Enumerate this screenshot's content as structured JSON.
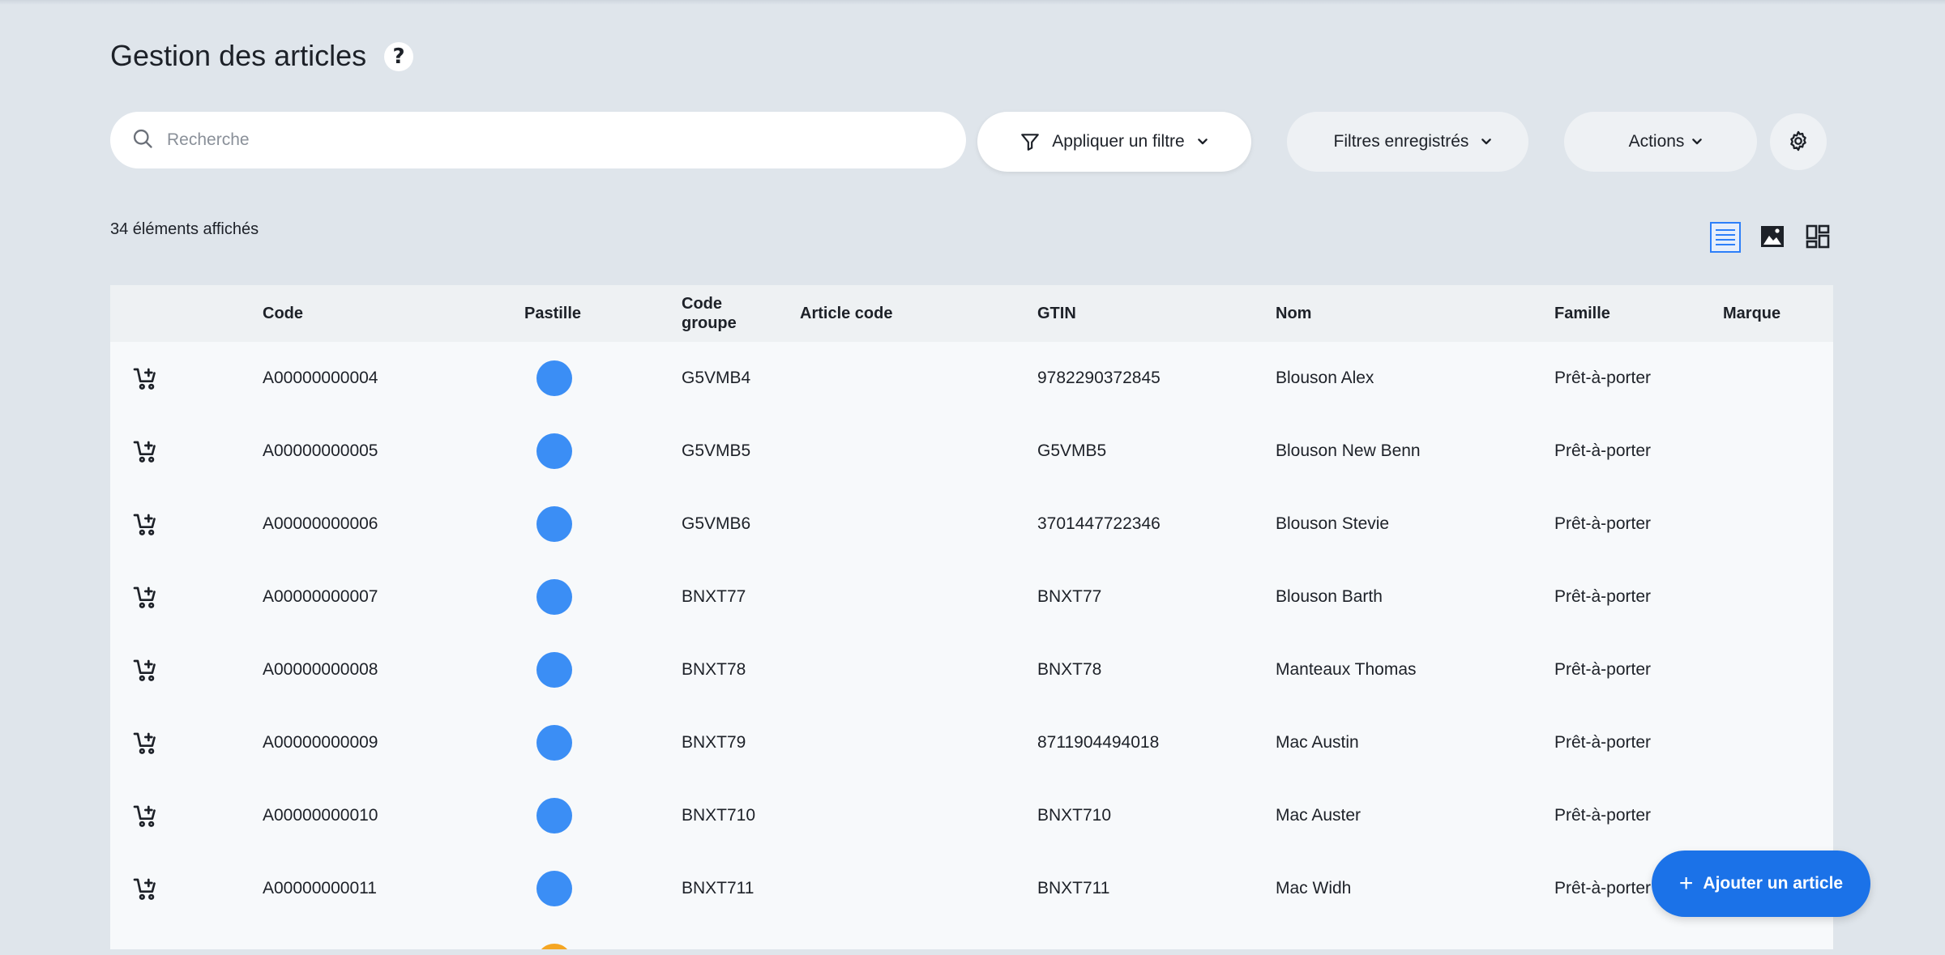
{
  "page": {
    "title": "Gestion des articles",
    "help": "?"
  },
  "search": {
    "placeholder": "Recherche",
    "value": ""
  },
  "toolbar": {
    "filter_label": "Appliquer un filtre",
    "saved_filters_label": "Filtres enregistrés",
    "actions_label": "Actions"
  },
  "summary": {
    "count_text": "34 éléments affichés"
  },
  "table": {
    "headers": {
      "code": "Code",
      "pastille": "Pastille",
      "code_groupe_1": "Code",
      "code_groupe_2": "groupe",
      "article_code": "Article code",
      "gtin": "GTIN",
      "nom": "Nom",
      "famille": "Famille",
      "marque": "Marque"
    },
    "rows": [
      {
        "code": "A00000000004",
        "dot_color": "#3b8ef5",
        "group": "G5VMB4",
        "gtin": "9782290372845",
        "nom": "Blouson Alex",
        "famille": "Prêt-à-porter"
      },
      {
        "code": "A00000000005",
        "dot_color": "#3b8ef5",
        "group": "G5VMB5",
        "gtin": "G5VMB5",
        "nom": "Blouson New Benn",
        "famille": "Prêt-à-porter"
      },
      {
        "code": "A00000000006",
        "dot_color": "#3b8ef5",
        "group": "G5VMB6",
        "gtin": "3701447722346",
        "nom": "Blouson Stevie",
        "famille": "Prêt-à-porter"
      },
      {
        "code": "A00000000007",
        "dot_color": "#3b8ef5",
        "group": "BNXT77",
        "gtin": "BNXT77",
        "nom": "Blouson Barth",
        "famille": "Prêt-à-porter"
      },
      {
        "code": "A00000000008",
        "dot_color": "#3b8ef5",
        "group": "BNXT78",
        "gtin": "BNXT78",
        "nom": "Manteaux Thomas",
        "famille": "Prêt-à-porter"
      },
      {
        "code": "A00000000009",
        "dot_color": "#3b8ef5",
        "group": "BNXT79",
        "gtin": "8711904494018",
        "nom": "Mac Austin",
        "famille": "Prêt-à-porter"
      },
      {
        "code": "A00000000010",
        "dot_color": "#3b8ef5",
        "group": "BNXT710",
        "gtin": "BNXT710",
        "nom": "Mac Auster",
        "famille": "Prêt-à-porter"
      },
      {
        "code": "A00000000011",
        "dot_color": "#3b8ef5",
        "group": "BNXT711",
        "gtin": "BNXT711",
        "nom": "Mac Widh",
        "famille": "Prêt-à-porter"
      },
      {
        "code": "",
        "dot_color": "#f5a623",
        "group": "",
        "gtin": "",
        "nom": "",
        "famille": ""
      }
    ]
  },
  "fab": {
    "label": "Ajouter un article",
    "plus": "+"
  },
  "icons": {
    "search": "search-icon",
    "filter": "filter-icon",
    "chevron": "chevron-down-icon",
    "settings": "gear-icon",
    "list_view": "list-view-icon",
    "image_view": "image-view-icon",
    "grid_view": "grid-view-icon",
    "cart": "add-to-cart-icon"
  },
  "colors": {
    "accent": "#1b72e8",
    "background": "#dfe5eb"
  }
}
